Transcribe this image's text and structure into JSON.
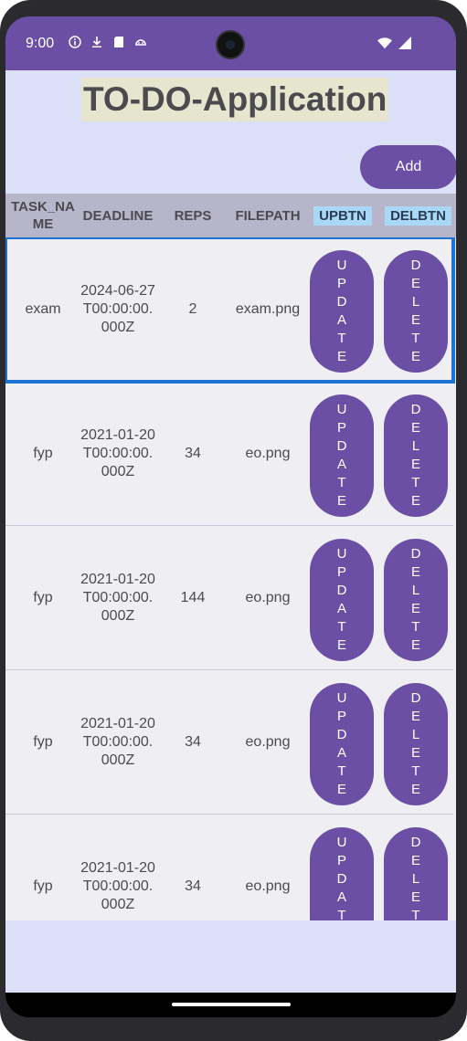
{
  "status_bar": {
    "time": "9:00",
    "left_icons": [
      "info-icon",
      "download-icon",
      "sd-card-icon",
      "android-icon"
    ],
    "right_icons": [
      "wifi-icon",
      "signal-icon"
    ]
  },
  "app": {
    "title": "TO-DO-Application",
    "add_label": "Add",
    "colors": {
      "accent": "#6a4fa5",
      "background": "#dcdff8",
      "header": "#b7b5c9",
      "title_bg": "#e6e6cf",
      "selection": "#1d72d6"
    }
  },
  "table": {
    "headers": {
      "task": "TASK_NAME",
      "deadline": "DEADLINE",
      "reps": "REPS",
      "filepath": "FILEPATH",
      "up": "UPBTN",
      "del": "DELBTN"
    },
    "update_label": "UPDATE",
    "delete_label": "DELETE",
    "rows": [
      {
        "task": "exam",
        "deadline": "2024-06-27T00:00:00.000Z",
        "reps": "2",
        "filepath": "exam.png"
      },
      {
        "task": "fyp",
        "deadline": "2021-01-20T00:00:00.000Z",
        "reps": "34",
        "filepath": "eo.png"
      },
      {
        "task": "fyp",
        "deadline": "2021-01-20T00:00:00.000Z",
        "reps": "144",
        "filepath": "eo.png"
      },
      {
        "task": "fyp",
        "deadline": "2021-01-20T00:00:00.000Z",
        "reps": "34",
        "filepath": "eo.png"
      },
      {
        "task": "fyp",
        "deadline": "2021-01-20T00:00:00.000Z",
        "reps": "34",
        "filepath": "eo.png"
      }
    ]
  }
}
